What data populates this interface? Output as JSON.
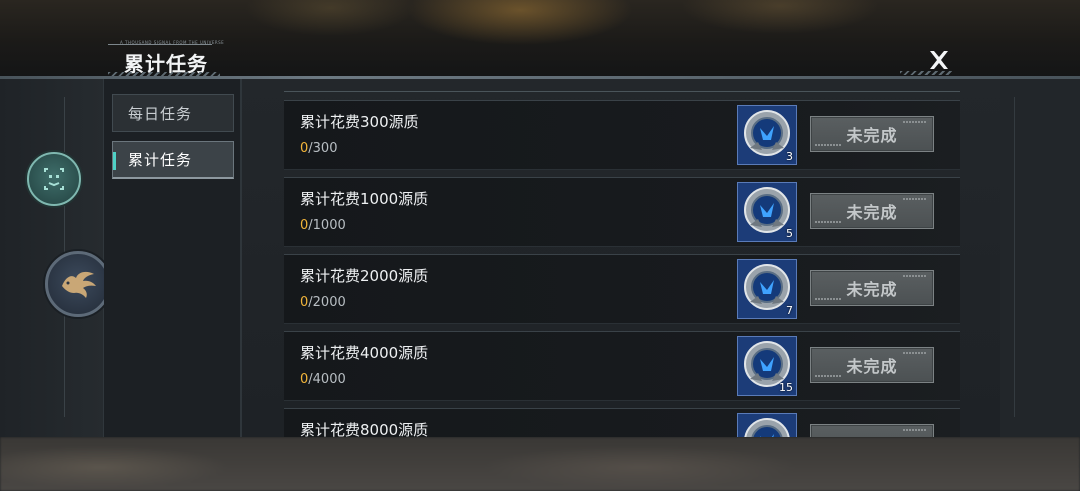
{
  "header": {
    "title": "累计任务",
    "tagline": "A THOUSAND SIGNAL FROM THE UNIVERSE"
  },
  "tabs": [
    {
      "label": "每日任务",
      "active": false
    },
    {
      "label": "累计任务",
      "active": true
    }
  ],
  "side_buttons": [
    {
      "icon": "face-scan-icon"
    },
    {
      "icon": "phoenix-emblem-icon"
    }
  ],
  "tasks": [
    {
      "title": "累计花费300源质",
      "current": "0",
      "target": "/300",
      "reward_count": "3",
      "status": "未完成"
    },
    {
      "title": "累计花费1000源质",
      "current": "0",
      "target": "/1000",
      "reward_count": "5",
      "status": "未完成"
    },
    {
      "title": "累计花费2000源质",
      "current": "0",
      "target": "/2000",
      "reward_count": "7",
      "status": "未完成"
    },
    {
      "title": "累计花费4000源质",
      "current": "0",
      "target": "/4000",
      "reward_count": "15",
      "status": "未完成"
    },
    {
      "title": "累计花费8000源质",
      "current": "",
      "target": "",
      "reward_count": "",
      "status": ""
    }
  ],
  "colors": {
    "accent_teal": "#4fd1c5",
    "progress_current": "#f2b53a",
    "reward_bg": "#1c3c78"
  }
}
